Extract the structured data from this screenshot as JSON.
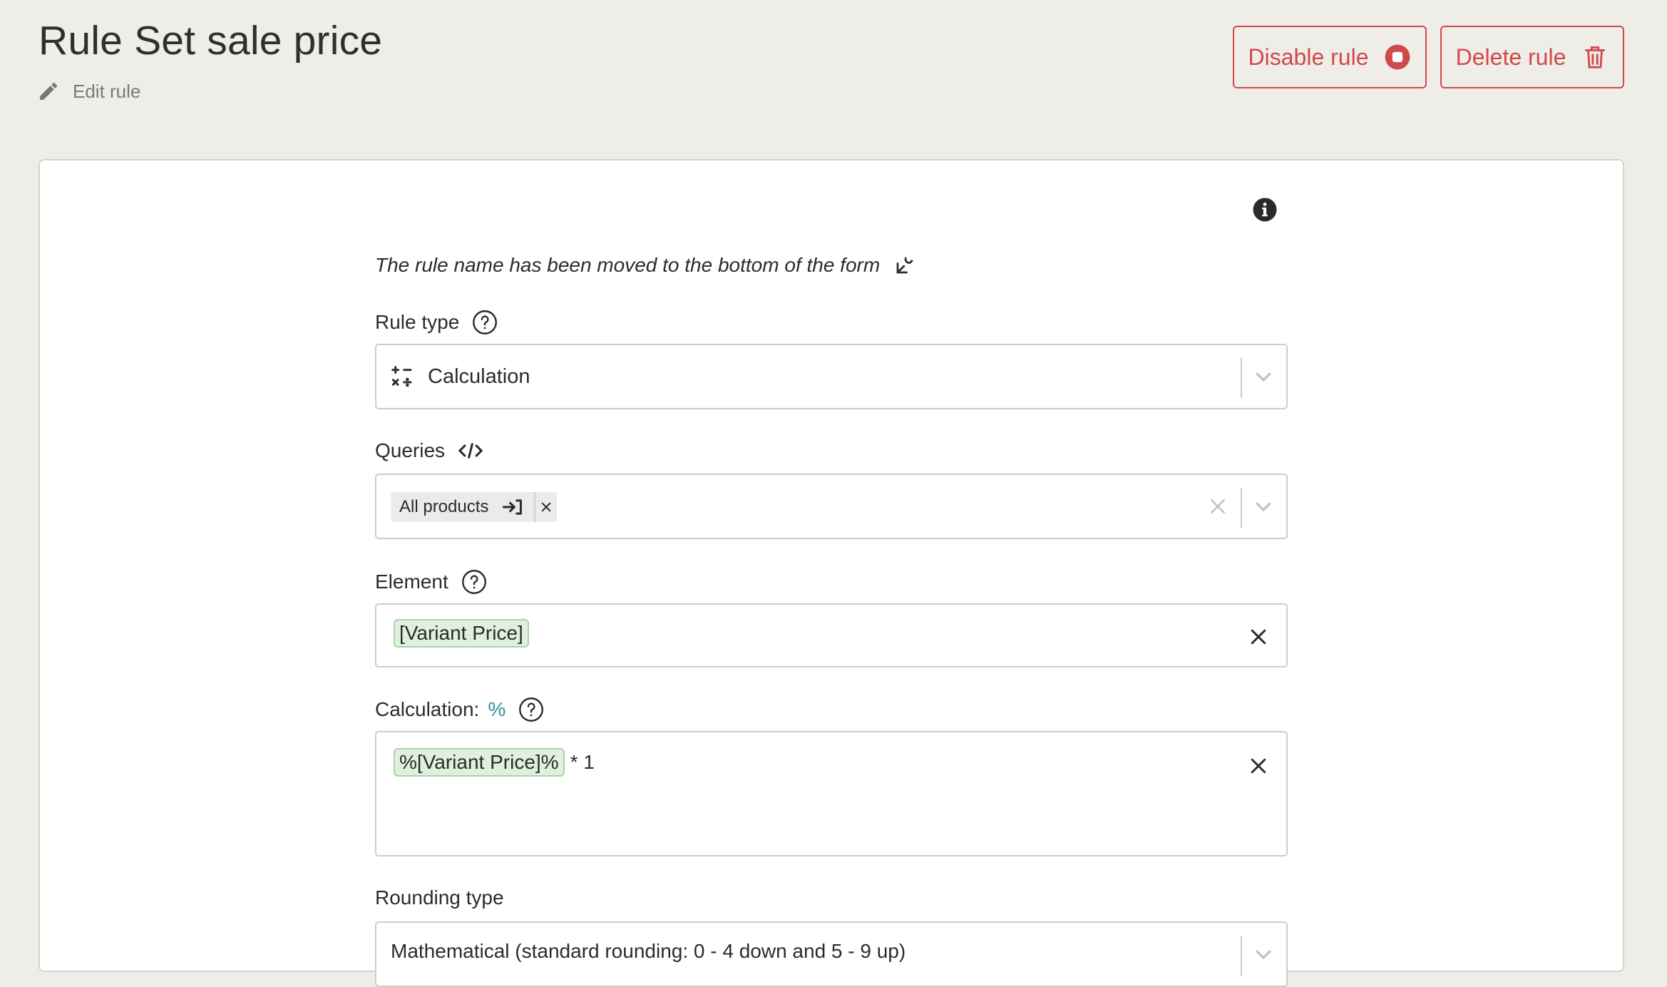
{
  "header": {
    "title": "Rule Set sale price",
    "edit_label": "Edit rule",
    "disable_label": "Disable rule",
    "delete_label": "Delete rule"
  },
  "form": {
    "notice": "The rule name has been moved to the bottom of the form",
    "rule_type": {
      "label": "Rule type",
      "value": "Calculation"
    },
    "queries": {
      "label": "Queries",
      "chips": [
        "All products"
      ]
    },
    "element": {
      "label": "Element",
      "token": "[Variant Price]"
    },
    "calculation": {
      "label": "Calculation:",
      "symbol": "%",
      "token": "%[Variant Price]%",
      "rest": "* 1"
    },
    "rounding": {
      "label": "Rounding type",
      "value": "Mathematical (standard rounding: 0 - 4 down and 5 - 9 up)"
    }
  },
  "colors": {
    "danger": "#d0494b",
    "token_bg": "#dff0de",
    "percent_accent": "#2e8ea0",
    "background": "#efede8"
  },
  "icons": [
    "pencil-icon",
    "stop-circle-icon",
    "trash-icon",
    "info-icon",
    "edit-wrench-icon",
    "help-icon",
    "calculator-icon",
    "chevron-down-icon",
    "code-icon",
    "sign-in-icon",
    "close-icon"
  ]
}
